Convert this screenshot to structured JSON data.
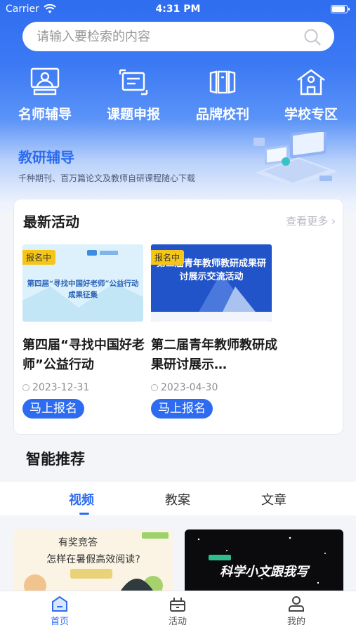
{
  "status_bar": {
    "carrier": "Carrier",
    "time": "4:31 PM",
    "battery_level": 0.95
  },
  "search": {
    "placeholder": "请输入要检索的内容",
    "icon": "search-icon"
  },
  "quick_nav": [
    {
      "label": "名师辅导",
      "icon": "teacher-icon"
    },
    {
      "label": "课题申报",
      "icon": "project-icon"
    },
    {
      "label": "品牌校刊",
      "icon": "journal-icon"
    },
    {
      "label": "学校专区",
      "icon": "school-icon"
    }
  ],
  "banner": {
    "title": "教研辅导",
    "subtitle": "千种期刊、百万篇论文及教师自研课程随心下载"
  },
  "activities": {
    "title": "最新活动",
    "see_more": "查看更多",
    "items": [
      {
        "tag": "报名中",
        "name": "第四届“寻找中国好老师”公益行动",
        "image_text": "第四届“寻找中国好老师”公益行动成果征集",
        "date": "2023-12-31",
        "button": "马上报名"
      },
      {
        "tag": "报名中",
        "name": "第二届青年教师教研成果研讨展示…",
        "image_text": "第二届青年教师教研成果研讨展示交流活动",
        "date": "2023-04-30",
        "button": "马上报名"
      }
    ]
  },
  "recommend": {
    "title": "智能推荐",
    "tabs": [
      "视频",
      "教案",
      "文章"
    ],
    "active_tab": 0,
    "videos": [
      {
        "line1": "有奖竞答",
        "line2": "怎样在暑假高效阅读?"
      },
      {
        "line1": "科学小文跟我写"
      }
    ]
  },
  "bottom_nav": [
    {
      "label": "首页",
      "icon": "home-icon",
      "active": true
    },
    {
      "label": "活动",
      "icon": "gift-icon",
      "active": false
    },
    {
      "label": "我的",
      "icon": "user-icon",
      "active": false
    }
  ],
  "colors": {
    "primary": "#2d6cf0",
    "tag": "#f5c518"
  }
}
